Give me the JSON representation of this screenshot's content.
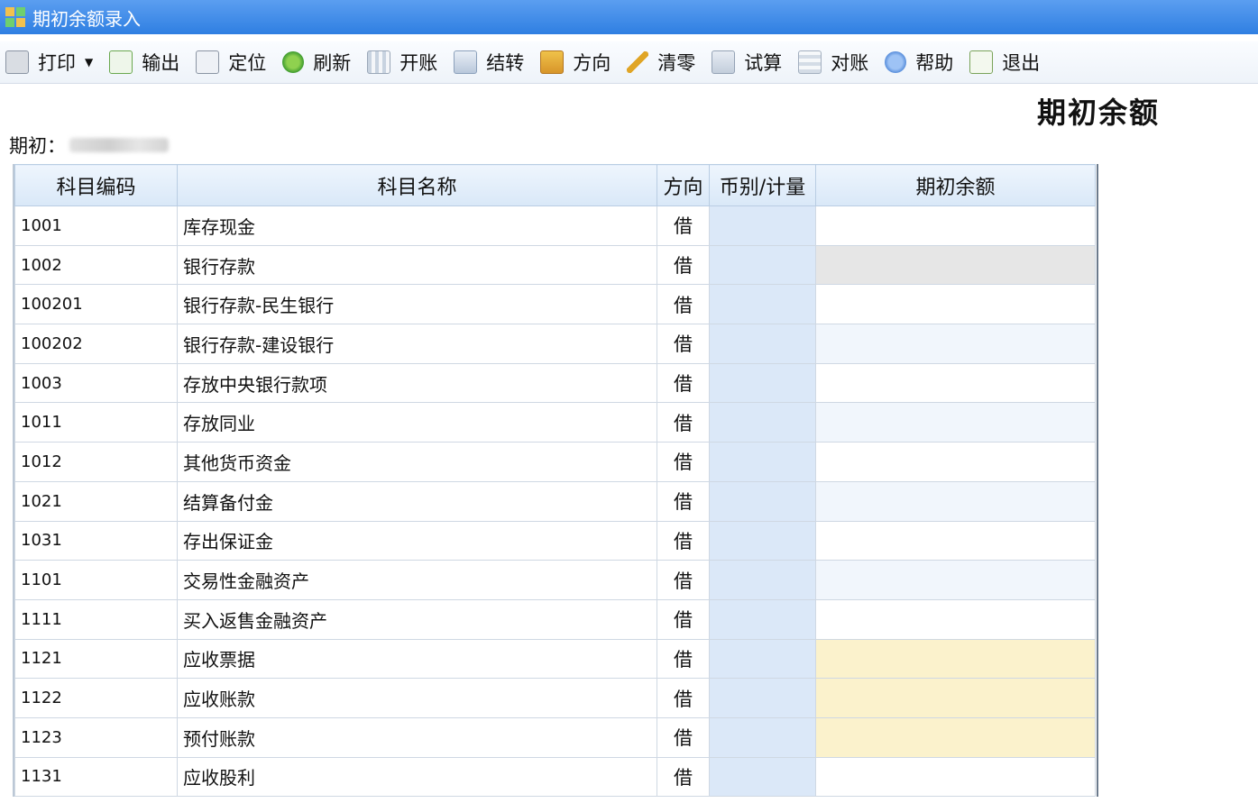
{
  "window": {
    "title": "期初余额录入"
  },
  "toolbar": {
    "items": [
      {
        "id": "print",
        "label": "打印",
        "icon": "printer-icon",
        "has_caret": true
      },
      {
        "id": "export",
        "label": "输出",
        "icon": "export-icon"
      },
      {
        "id": "locate",
        "label": "定位",
        "icon": "locate-icon"
      },
      {
        "id": "refresh",
        "label": "刷新",
        "icon": "refresh-icon"
      },
      {
        "id": "open-account",
        "label": "开账",
        "icon": "open-account-icon"
      },
      {
        "id": "carry-forward",
        "label": "结转",
        "icon": "carry-forward-icon"
      },
      {
        "id": "direction",
        "label": "方向",
        "icon": "direction-icon"
      },
      {
        "id": "clear",
        "label": "清零",
        "icon": "broom-icon"
      },
      {
        "id": "trial-balance",
        "label": "试算",
        "icon": "calculator-icon"
      },
      {
        "id": "reconcile",
        "label": "对账",
        "icon": "reconcile-icon"
      },
      {
        "id": "help",
        "label": "帮助",
        "icon": "help-icon"
      },
      {
        "id": "exit",
        "label": "退出",
        "icon": "exit-icon"
      }
    ]
  },
  "report": {
    "title": "期初余额",
    "period_label": "期初："
  },
  "grid": {
    "columns": [
      "科目编码",
      "科目名称",
      "方向",
      "币别/计量",
      "期初余额"
    ],
    "rows": [
      {
        "code": "1001",
        "name": "库存现金",
        "dir": "借",
        "indent": false,
        "bal_state": "normal"
      },
      {
        "code": "1002",
        "name": "银行存款",
        "dir": "借",
        "indent": false,
        "bal_state": "gray"
      },
      {
        "code": "100201",
        "name": "银行存款-民生银行",
        "dir": "借",
        "indent": true,
        "bal_state": "normal"
      },
      {
        "code": "100202",
        "name": "银行存款-建设银行",
        "dir": "借",
        "indent": true,
        "bal_state": "normal"
      },
      {
        "code": "1003",
        "name": "存放中央银行款项",
        "dir": "借",
        "indent": false,
        "bal_state": "normal"
      },
      {
        "code": "1011",
        "name": "存放同业",
        "dir": "借",
        "indent": false,
        "bal_state": "normal"
      },
      {
        "code": "1012",
        "name": "其他货币资金",
        "dir": "借",
        "indent": false,
        "bal_state": "normal"
      },
      {
        "code": "1021",
        "name": "结算备付金",
        "dir": "借",
        "indent": false,
        "bal_state": "normal"
      },
      {
        "code": "1031",
        "name": "存出保证金",
        "dir": "借",
        "indent": false,
        "bal_state": "normal"
      },
      {
        "code": "1101",
        "name": "交易性金融资产",
        "dir": "借",
        "indent": false,
        "bal_state": "normal"
      },
      {
        "code": "1111",
        "name": "买入返售金融资产",
        "dir": "借",
        "indent": false,
        "bal_state": "normal"
      },
      {
        "code": "1121",
        "name": "应收票据",
        "dir": "借",
        "indent": false,
        "bal_state": "yellow"
      },
      {
        "code": "1122",
        "name": "应收账款",
        "dir": "借",
        "indent": false,
        "bal_state": "yellow"
      },
      {
        "code": "1123",
        "name": "预付账款",
        "dir": "借",
        "indent": false,
        "bal_state": "yellow"
      },
      {
        "code": "1131",
        "name": "应收股利",
        "dir": "借",
        "indent": false,
        "bal_state": "normal"
      }
    ]
  },
  "colors": {
    "titlebar": "#2f7fe2",
    "currency_cell": "#dbe8f8",
    "locked_cell": "#e6e6e6",
    "highlight_cell": "#fbf2cc"
  }
}
